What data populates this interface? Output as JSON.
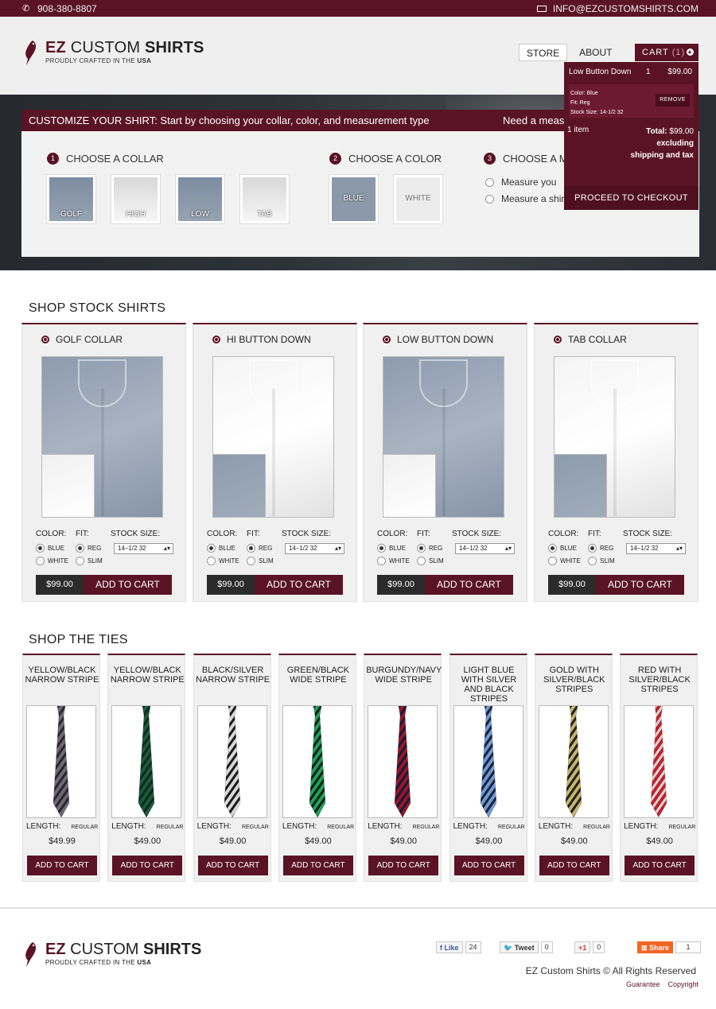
{
  "topbar": {
    "phone": "908-380-8807",
    "email": "INFO@EZCUSTOMSHIRTS.COM"
  },
  "brand": {
    "ez": "EZ",
    "name_custom": "CUSTOM",
    "name_shirts": "SHIRTS",
    "tagline": "PROUDLY CRAFTED IN THE",
    "tagline_bold": "USA"
  },
  "nav": {
    "store": "STORE",
    "about": "ABOUT",
    "cart": "CART",
    "cart_count": "(1)"
  },
  "cart": {
    "item_name": "Low Button Down",
    "item_qty": "1",
    "item_price": "$99.00",
    "color": "Color: Blue",
    "fit": "Fit: Reg",
    "size": "Stock Size: 14-1/2 32",
    "remove": "REMOVE",
    "items": "1 item",
    "total_label": "Total:",
    "total_value": "$99.00",
    "total_note": "excluding shipping and tax",
    "checkout": "PROCEED TO CHECKOUT"
  },
  "customize": {
    "bar_text": "CUSTOMIZE YOUR SHIRT: Start by choosing your collar, color, and measurement type",
    "need": "Need a meas",
    "step1": {
      "num": "1",
      "label": "CHOOSE A COLLAR"
    },
    "step2": {
      "num": "2",
      "label": "CHOOSE A COLOR"
    },
    "step3": {
      "num": "3",
      "label": "CHOOSE A M"
    },
    "collars": [
      "GOLF",
      "HIGH",
      "LOW",
      "TAB"
    ],
    "colors": [
      "BLUE",
      "WHITE"
    ],
    "measure": [
      "Measure you",
      "Measure a shirt"
    ]
  },
  "shop_shirts": {
    "title": "SHOP STOCK SHIRTS",
    "color_label": "COLOR:",
    "fit_label": "FIT:",
    "size_label": "STOCK SIZE:",
    "blue": "BLUE",
    "white": "WHITE",
    "reg": "REG",
    "slim": "SLIM",
    "size_value": "14–1/2 32",
    "add": "ADD TO CART",
    "items": [
      {
        "name": "GOLF COLLAR",
        "price": "$99.00",
        "main": "blue"
      },
      {
        "name": "HI BUTTON DOWN",
        "price": "$99.00",
        "main": "white"
      },
      {
        "name": "LOW BUTTON DOWN",
        "price": "$99.00",
        "main": "blue"
      },
      {
        "name": "TAB COLLAR",
        "price": "$99.00",
        "main": "white"
      }
    ]
  },
  "shop_ties": {
    "title": "SHOP THE TIES",
    "length_label": "LENGTH:",
    "length_value": "REGULAR",
    "add": "ADD TO CART",
    "items": [
      {
        "name": "YELLOW/BLACK NARROW STRIPE",
        "price": "$49.99",
        "c1": "#6f6875",
        "c2": "#2a2630"
      },
      {
        "name": "YELLOW/BLACK NARROW STRIPE",
        "price": "$49.00",
        "c1": "#1c5a3c",
        "c2": "#0e2a1c"
      },
      {
        "name": "BLACK/SILVER NARROW STRIPE",
        "price": "$49.00",
        "c1": "#d8d8d8",
        "c2": "#1a1a1a"
      },
      {
        "name": "GREEN/BLACK WIDE STRIPE",
        "price": "$49.00",
        "c1": "#1fa05a",
        "c2": "#122016"
      },
      {
        "name": "BURGUNDY/NAVY WIDE STRIPE",
        "price": "$49.00",
        "c1": "#9a1626",
        "c2": "#151b3a"
      },
      {
        "name": "LIGHT BLUE WITH SILVER AND BLACK STRIPES",
        "price": "$49.00",
        "c1": "#6f9ad8",
        "c2": "#1a2233"
      },
      {
        "name": "GOLD WITH SILVER/BLACK STRIPES",
        "price": "$49.00",
        "c1": "#c7b46a",
        "c2": "#202020"
      },
      {
        "name": "RED WITH SILVER/BLACK STRIPES",
        "price": "$49.00",
        "c1": "#c2202c",
        "c2": "#d8d8d8"
      }
    ]
  },
  "footer": {
    "like": "Like",
    "like_count": "24",
    "tweet": "Tweet",
    "tweet_count": "0",
    "plus": "+1",
    "plus_count": "0",
    "share": "Share",
    "share_count": "1",
    "copyright": "EZ Custom Shirts © All Rights Reserved",
    "guarantee": "Guarantee",
    "copyright_link": "Copyright"
  },
  "colors": {
    "brand": "#5a1325",
    "dark": "#2b2b2b"
  }
}
